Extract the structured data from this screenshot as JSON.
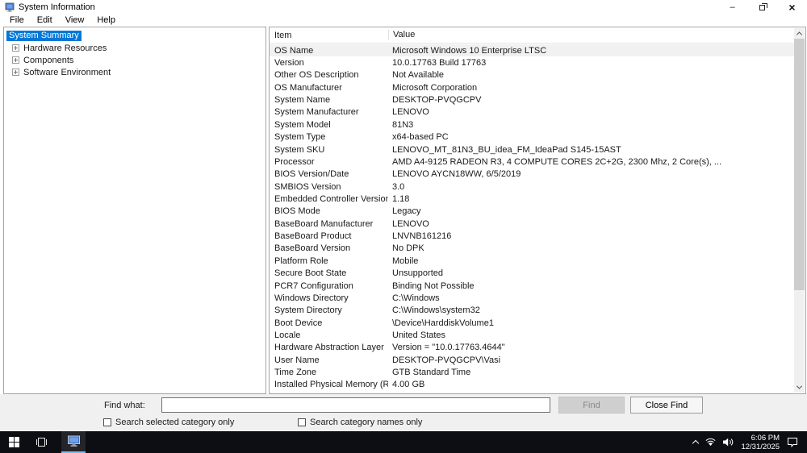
{
  "window": {
    "title": "System Information",
    "controls": {
      "minimize": "–",
      "close": "×"
    }
  },
  "menu": {
    "items": [
      {
        "label": "File"
      },
      {
        "label": "Edit"
      },
      {
        "label": "View"
      },
      {
        "label": "Help"
      }
    ]
  },
  "tree": {
    "selected_item": "System Summary",
    "items": [
      {
        "label": "Hardware Resources"
      },
      {
        "label": "Components"
      },
      {
        "label": "Software Environment"
      }
    ]
  },
  "table": {
    "columns": [
      "Item",
      "Value"
    ],
    "selected_row_index": 0,
    "rows": [
      {
        "item": "OS Name",
        "value": "Microsoft Windows 10 Enterprise LTSC"
      },
      {
        "item": "Version",
        "value": "10.0.17763 Build 17763"
      },
      {
        "item": "Other OS Description",
        "value": "Not Available"
      },
      {
        "item": "OS Manufacturer",
        "value": "Microsoft Corporation"
      },
      {
        "item": "System Name",
        "value": "DESKTOP-PVQGCPV"
      },
      {
        "item": "System Manufacturer",
        "value": "LENOVO"
      },
      {
        "item": "System Model",
        "value": "81N3"
      },
      {
        "item": "System Type",
        "value": "x64-based PC"
      },
      {
        "item": "System SKU",
        "value": "LENOVO_MT_81N3_BU_idea_FM_IdeaPad S145-15AST"
      },
      {
        "item": "Processor",
        "value": "AMD A4-9125 RADEON R3, 4 COMPUTE CORES 2C+2G, 2300 Mhz, 2 Core(s), ..."
      },
      {
        "item": "BIOS Version/Date",
        "value": "LENOVO AYCN18WW, 6/5/2019"
      },
      {
        "item": "SMBIOS Version",
        "value": "3.0"
      },
      {
        "item": "Embedded Controller Version",
        "value": "1.18"
      },
      {
        "item": "BIOS Mode",
        "value": "Legacy"
      },
      {
        "item": "BaseBoard Manufacturer",
        "value": "LENOVO"
      },
      {
        "item": "BaseBoard Product",
        "value": "LNVNB161216"
      },
      {
        "item": "BaseBoard Version",
        "value": "No DPK"
      },
      {
        "item": "Platform Role",
        "value": "Mobile"
      },
      {
        "item": "Secure Boot State",
        "value": "Unsupported"
      },
      {
        "item": "PCR7 Configuration",
        "value": "Binding Not Possible"
      },
      {
        "item": "Windows Directory",
        "value": "C:\\Windows"
      },
      {
        "item": "System Directory",
        "value": "C:\\Windows\\system32"
      },
      {
        "item": "Boot Device",
        "value": "\\Device\\HarddiskVolume1"
      },
      {
        "item": "Locale",
        "value": "United States"
      },
      {
        "item": "Hardware Abstraction Layer",
        "value": "Version = \"10.0.17763.4644\""
      },
      {
        "item": "User Name",
        "value": "DESKTOP-PVQGCPV\\Vasi"
      },
      {
        "item": "Time Zone",
        "value": "GTB Standard Time"
      },
      {
        "item": "Installed Physical Memory (RAM)",
        "value": "4.00 GB"
      }
    ]
  },
  "find": {
    "label": "Find what:",
    "input_value": "",
    "find_button": "Find",
    "close_find_button": "Close Find",
    "search_selected_category_label": "Search selected category only",
    "search_category_names_label": "Search category names only"
  },
  "taskbar": {
    "time": "6:06 PM",
    "date": "12/31/2025"
  },
  "colors": {
    "selection_blue": "#0078d7",
    "row_highlight": "#f1f1f1",
    "taskbar_bg": "#0d0e13",
    "taskbar_accent": "#76b9ed"
  }
}
